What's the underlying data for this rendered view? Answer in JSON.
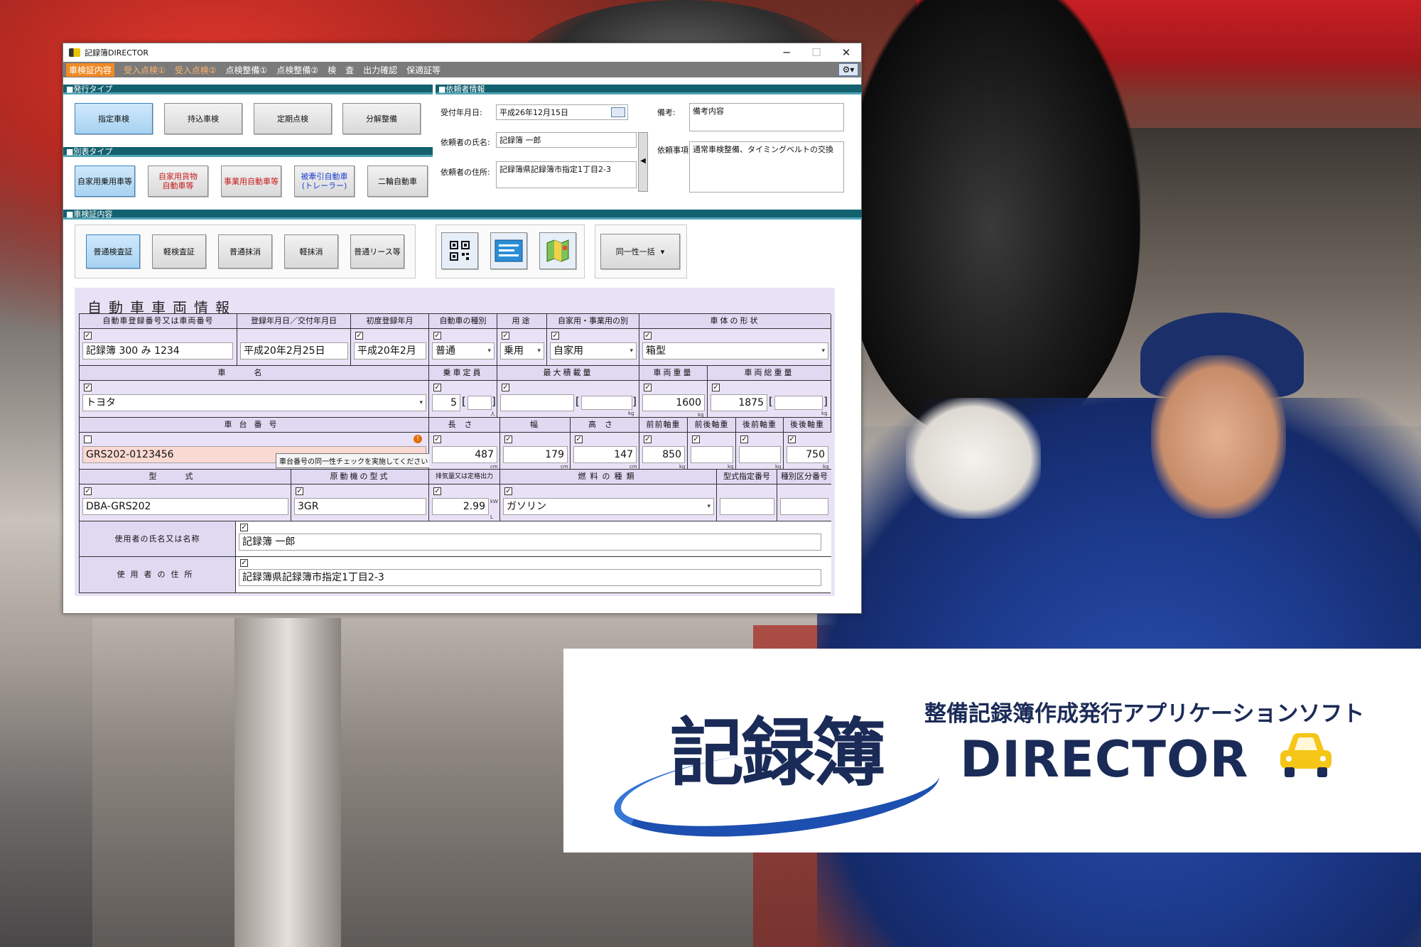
{
  "window": {
    "title": "記録簿DIRECTOR",
    "controls": [
      "─",
      "☐",
      "✕"
    ]
  },
  "menu": {
    "items": [
      "車検証内容",
      "受入点検①",
      "受入点検②",
      "点検整備①",
      "点検整備②",
      "検",
      "査",
      "出力確認",
      "保適証等"
    ],
    "settings_icon": "⚙▾"
  },
  "issue_type": {
    "header": "■発行タイプ",
    "buttons": [
      "指定車検",
      "持込車検",
      "定期点検",
      "分解整備"
    ],
    "selected": 0
  },
  "category": {
    "header": "■別表タイプ",
    "buttons": [
      "自家用乗用車等",
      "自家用貨物\n自動車等",
      "事業用自動車等",
      "被牽引自動車\n(トレーラー)",
      "二輪自動車"
    ],
    "selected": 0
  },
  "requester": {
    "header": "■依頼者情報",
    "date_label": "受付年月日:",
    "date_value": "平成26年12月15日",
    "name_label": "依頼者の氏名:",
    "name_value": "記録簿  一郎",
    "address_label": "依頼者の住所:",
    "address_value": "記録簿県記録簿市指定1丁目2-3",
    "expand_arrow": "◀",
    "remarks_label": "備考:",
    "remarks_value": "備考内容",
    "request_label": "依頼事項:",
    "request_value": "通常車検整備、タイミングベルトの交換"
  },
  "certificate": {
    "header": "■車検証内容",
    "buttons": [
      "普通検査証",
      "軽検査証",
      "普通抹消",
      "軽抹消",
      "普通リース等"
    ],
    "selected": 0,
    "tool_icons": [
      "qr-code-icon",
      "scan-card-icon",
      "map-icon"
    ],
    "dropdown_label": "同一性一括",
    "dropdown_arrow": "▾"
  },
  "vehicle": {
    "title": "自動車車両情報",
    "row1": {
      "headers": [
        "自動車登録番号又は車両番号",
        "登録年月日／交付年月日",
        "初度登録年月",
        "自動車の種別",
        "用途",
        "自家用・事業用の別",
        "車体の形状"
      ],
      "values": [
        "記録簿 300 み 1234",
        "平成20年2月25日",
        "平成20年2月",
        "普通",
        "乗用",
        "自家用",
        "箱型"
      ]
    },
    "row2": {
      "headers": [
        "車名",
        "乗車定員",
        "最大積載量",
        "車両重量",
        "車両総重量"
      ],
      "car_name": "トヨタ",
      "capacity": "5",
      "capacity_unit": "人",
      "max_load": "",
      "vehicle_weight": "1600",
      "gross_weight": "1875",
      "kg": "kg"
    },
    "row3": {
      "headers": [
        "車台番号",
        "長さ",
        "幅",
        "高さ",
        "前前軸重",
        "前後軸重",
        "後前軸重",
        "後後軸重"
      ],
      "chassis": "GRS202-0123456",
      "tooltip": "車台番号の同一性チェックを実施してください",
      "warn_icon": "!",
      "length": "487",
      "width": "179",
      "height": "147",
      "ff_axle": "850",
      "fr_axle": "",
      "rf_axle": "",
      "rr_axle": "750",
      "cm": "cm"
    },
    "row4": {
      "headers": [
        "型式",
        "原動機の型式",
        "排気量又は定格出力",
        "燃料の種類",
        "型式指定番号",
        "種別区分番号"
      ],
      "model": "DBA-GRS202",
      "engine": "3GR",
      "displacement": "2.99",
      "disp_unit_top": "kW",
      "disp_unit_bottom": "L",
      "fuel": "ガソリン"
    },
    "owner_name_label": "使用者の氏名又は名称",
    "owner_name": "記録簿  一郎",
    "owner_address_label": "使用者の住所",
    "owner_address": "記録簿県記録簿市指定1丁目2-3",
    "check": "✓",
    "dropdown": "▾",
    "bracket_open": "[",
    "bracket_close": "]"
  },
  "logo": {
    "tagline": "整備記録簿作成発行アプリケーションソフト",
    "main": "記録簿",
    "sub": "DIRECTOR",
    "car_icon": "car-icon",
    "brand_color": "#1b2b57"
  }
}
